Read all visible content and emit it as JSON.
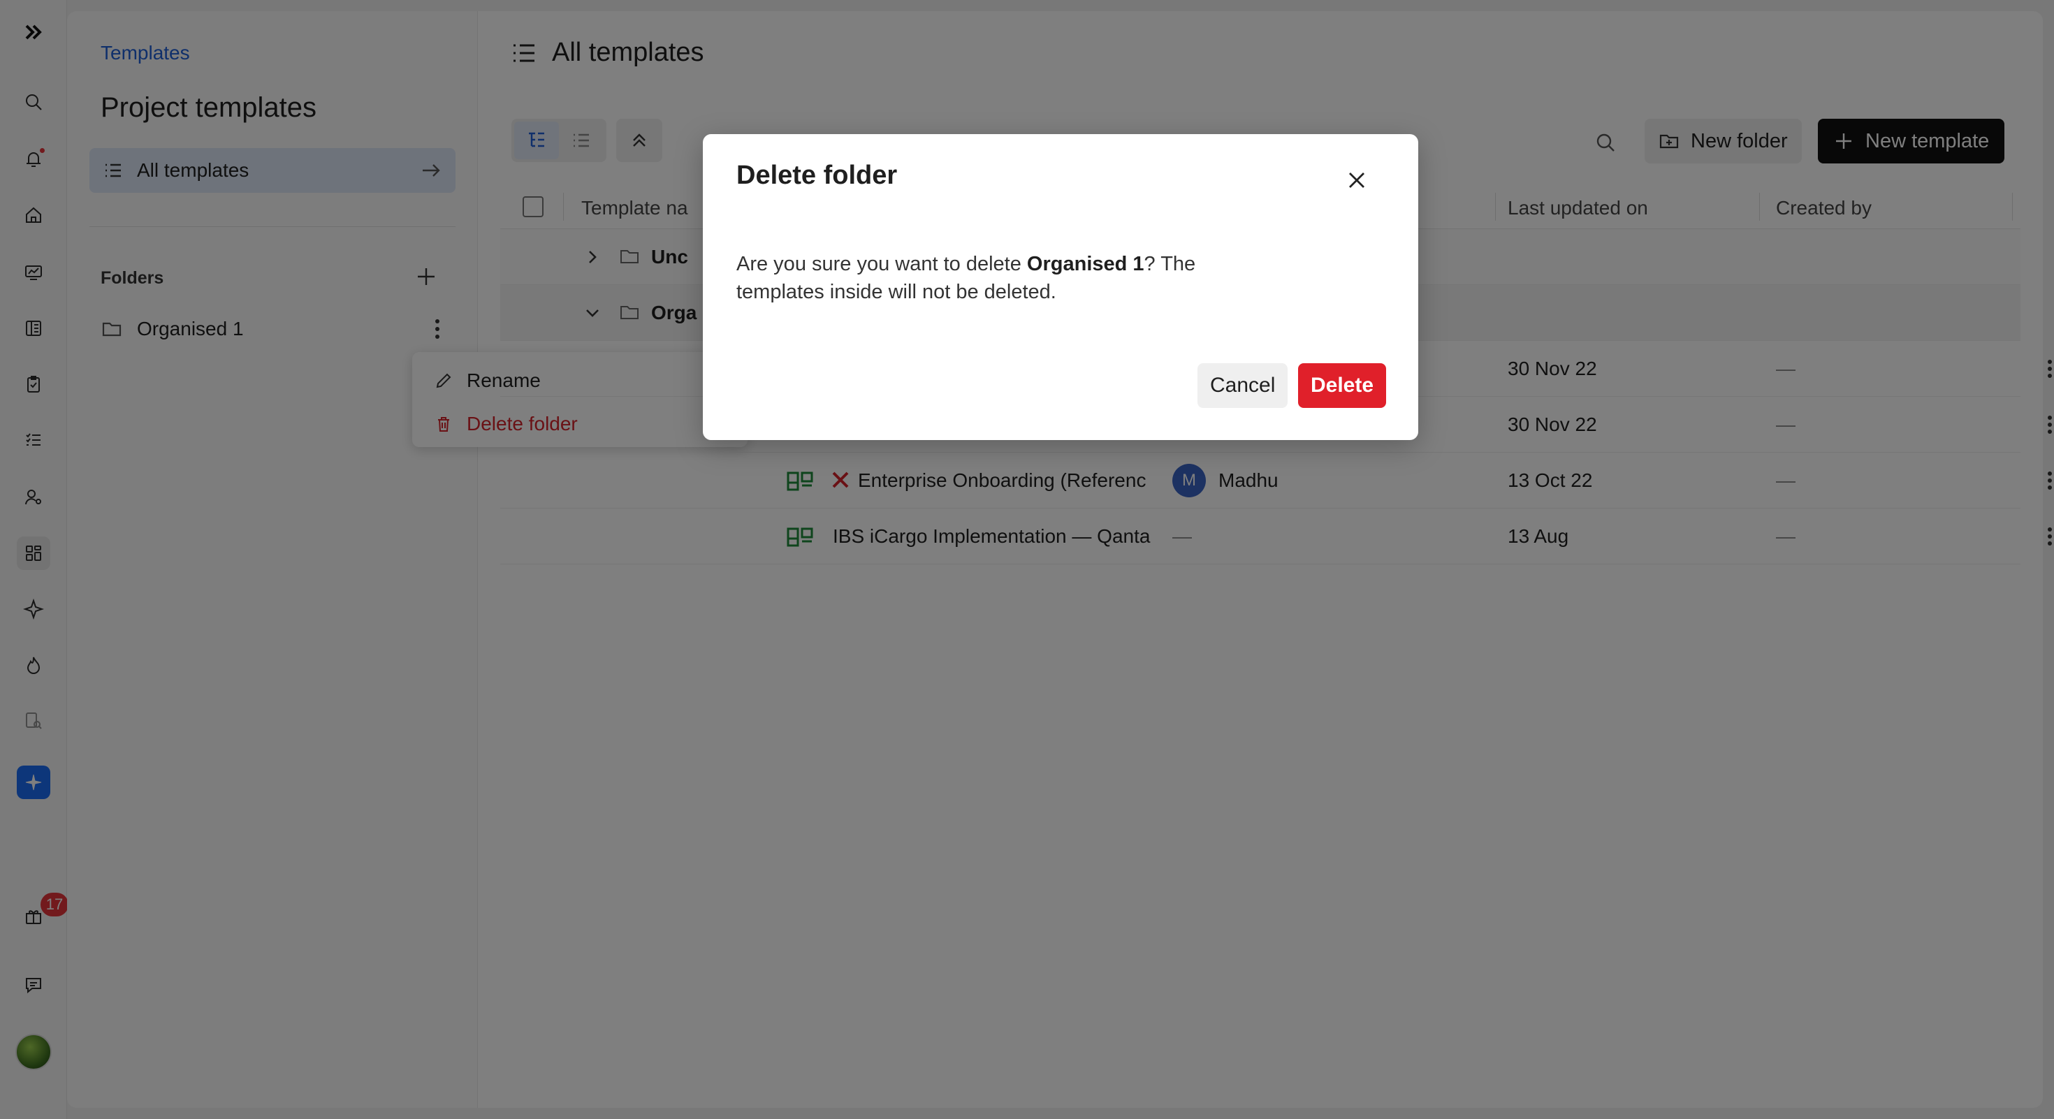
{
  "rail": {
    "icons": [
      "logo-icon",
      "search-icon",
      "bell-icon",
      "home-icon",
      "dashboard-icon",
      "workbook-icon",
      "clipboard-icon",
      "checklist-icon",
      "user-settings-icon",
      "templates-icon",
      "sparkle-icon",
      "flame-icon",
      "report-search-icon",
      "ai-assistant-icon",
      "gift-icon",
      "chat-icon"
    ],
    "gift_badge": "17"
  },
  "sidebar": {
    "breadcrumb": "Templates",
    "title": "Project templates",
    "all_templates_label": "All templates",
    "folders_label": "Folders",
    "folders": [
      {
        "label": "Organised 1"
      }
    ]
  },
  "context_menu": {
    "rename_label": "Rename",
    "delete_label": "Delete folder"
  },
  "main": {
    "title": "All templates",
    "new_folder_label": "New folder",
    "new_template_label": "New template",
    "columns": [
      "Template na",
      "Last updated on",
      "Created by"
    ],
    "groups": [
      {
        "name": "Unc"
      },
      {
        "name": "Orga"
      }
    ],
    "rows": [
      {
        "name": "",
        "owner": "",
        "date": "30 Nov 22",
        "created_by": "—"
      },
      {
        "name": "",
        "owner": "",
        "date": "30 Nov 22",
        "created_by": "—"
      },
      {
        "name": "Enterprise Onboarding (Referenc",
        "owner_initial": "M",
        "owner": "Madhu",
        "date": "13 Oct 22",
        "created_by": "—"
      },
      {
        "name": "IBS iCargo Implementation — Qanta",
        "owner": "—",
        "date": "13 Aug",
        "created_by": "—"
      }
    ]
  },
  "modal": {
    "title": "Delete folder",
    "body_prefix": "Are you sure you want to delete ",
    "folder_name": "Organised 1",
    "body_suffix": "? The templates inside will not be deleted.",
    "cancel_label": "Cancel",
    "delete_label": "Delete"
  },
  "colors": {
    "accent": "#1f5fd6",
    "danger": "#e0202a",
    "template_icon": "#1f8a3a"
  }
}
